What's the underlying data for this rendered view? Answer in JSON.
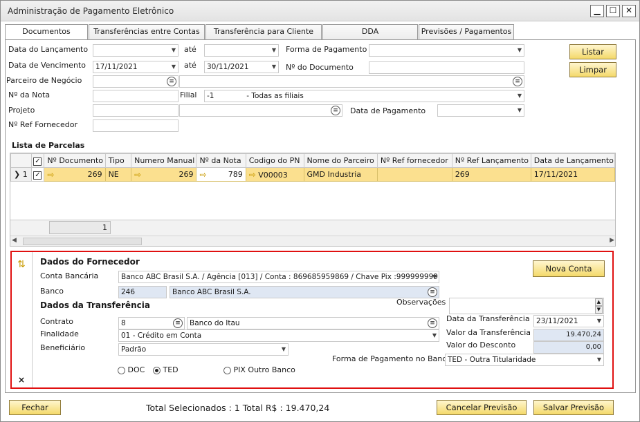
{
  "window": {
    "title": "Administração de Pagamento Eletrônico",
    "min_label": "▁",
    "max_label": "☐",
    "close_label": "✕"
  },
  "tabs": [
    {
      "label": "Documentos"
    },
    {
      "label": "Transferências entre Contas"
    },
    {
      "label": "Transferência para Cliente"
    },
    {
      "label": "DDA"
    },
    {
      "label": "Previsões / Pagamentos"
    }
  ],
  "filters": {
    "data_lancamento_label": "Data do Lançamento",
    "data_lancamento_from": "",
    "ate_label": "até",
    "data_lancamento_to": "",
    "forma_pagamento_label": "Forma de Pagamento",
    "forma_pagamento_value": "",
    "data_vencimento_label": "Data de Vencimento",
    "data_vencimento_from": "17/11/2021",
    "data_vencimento_to": "30/11/2021",
    "num_documento_label": "Nº do Documento",
    "num_documento_value": "",
    "parceiro_label": "Parceiro de Negócio",
    "num_nota_label": "Nº da Nota",
    "filial_label": "Filial",
    "filial_value": "-1              - Todas as filiais",
    "projeto_label": "Projeto",
    "data_pagamento_label": "Data de Pagamento",
    "ref_fornecedor_label": "Nº Ref Fornecedor"
  },
  "buttons": {
    "listar": "Listar",
    "limpar": "Limpar",
    "nova_conta": "Nova Conta",
    "fechar": "Fechar",
    "cancelar": "Cancelar Previsão",
    "salvar": "Salvar Previsão"
  },
  "list": {
    "title": "Lista de Parcelas",
    "columns": [
      "Nº Documento",
      "Tipo",
      "Numero Manual",
      "Nº da Nota",
      "Codigo do PN",
      "Nome do Parceiro",
      "Nº Ref fornecedor",
      "Nº Ref Lançamento",
      "Data de Lançamento"
    ],
    "row": {
      "index": "1",
      "documento": "269",
      "tipo": "NE",
      "numero_manual": "269",
      "nota": "789",
      "codigo_pn": "V00003",
      "nome_parceiro": "GMD Industria",
      "ref_fornecedor": "",
      "ref_lancamento": "269",
      "data_lancamento": "17/11/2021"
    },
    "footer_count": "1"
  },
  "detail": {
    "fornecedor_title": "Dados do Fornecedor",
    "conta_bancaria_label": "Conta Bancária",
    "conta_bancaria_value": "Banco ABC Brasil S.A. / Agência [013] / Conta : 869685959869  / Chave Pix :999999999",
    "banco_label": "Banco",
    "banco_code": "246",
    "banco_name": "Banco ABC Brasil S.A.",
    "transferencia_title": "Dados da Transferência",
    "observacoes_label": "Observações",
    "contrato_label": "Contrato",
    "contrato_code": "8",
    "contrato_name": "Banco do Itau",
    "finalidade_label": "Finalidade",
    "finalidade_value": "01 - Crédito em Conta",
    "beneficiario_label": "Beneficiário",
    "beneficiario_value": "Padrão",
    "data_transferencia_label": "Data da Transferência",
    "data_transferencia_value": "23/11/2021",
    "valor_transferencia_label": "Valor da Transferência",
    "valor_transferencia_value": "19.470,24",
    "valor_desconto_label": "Valor do Desconto",
    "valor_desconto_value": "0,00",
    "forma_pagamento_banco_label": "Forma de Pagamento no Banco",
    "forma_pagamento_banco_value": "TED - Outra Titularidade",
    "radio_doc": "DOC",
    "radio_ted": "TED",
    "radio_pix": "PIX Outro Banco",
    "selected_radio": "TED"
  },
  "footer": {
    "total_text": "Total Selecionados : 1 Total R$ : 19.470,24"
  }
}
